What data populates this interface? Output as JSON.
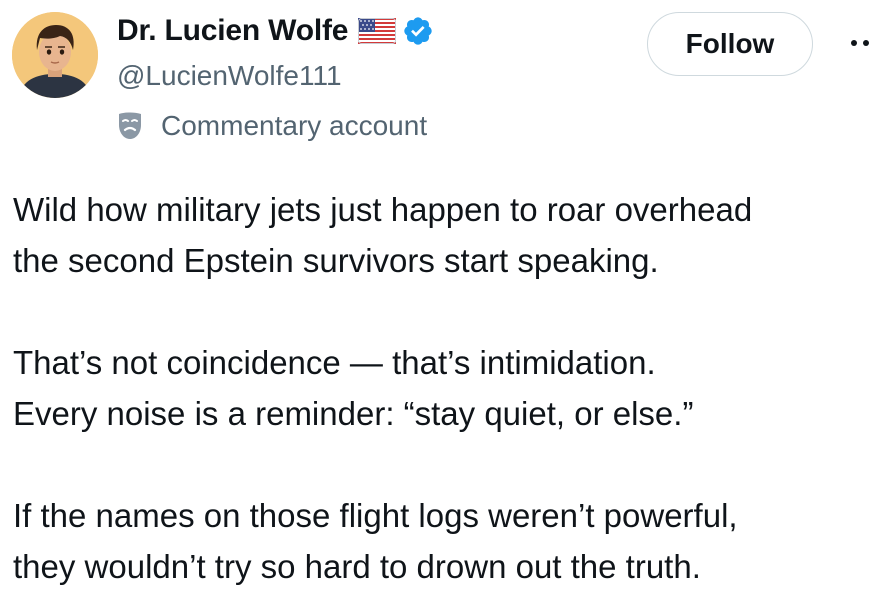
{
  "author": {
    "display_name": "Dr. Lucien Wolfe",
    "handle": "@LucienWolfe111",
    "flag_icon": "us-flag-icon",
    "verified_icon": "verified-badge-icon",
    "verified_color": "#1d9bf0"
  },
  "account_label": {
    "icon": "theater-mask-icon",
    "text": "Commentary account"
  },
  "follow_button": {
    "label": "Follow"
  },
  "more_menu": {
    "icon": "more-options-icon"
  },
  "post": {
    "paragraphs": [
      {
        "lines": [
          "Wild how military jets just happen to roar overhead",
          "the second Epstein survivors start speaking."
        ]
      },
      {
        "lines": [
          "That’s not coincidence — that’s intimidation.",
          "Every noise is a reminder: “stay quiet, or else.”"
        ]
      },
      {
        "lines": [
          "If the names on those flight logs weren’t powerful,",
          "they wouldn’t try so hard to drown out the truth."
        ]
      }
    ]
  },
  "colors": {
    "text_primary": "#0f1419",
    "text_secondary": "#536471",
    "border": "#cfd9de"
  }
}
